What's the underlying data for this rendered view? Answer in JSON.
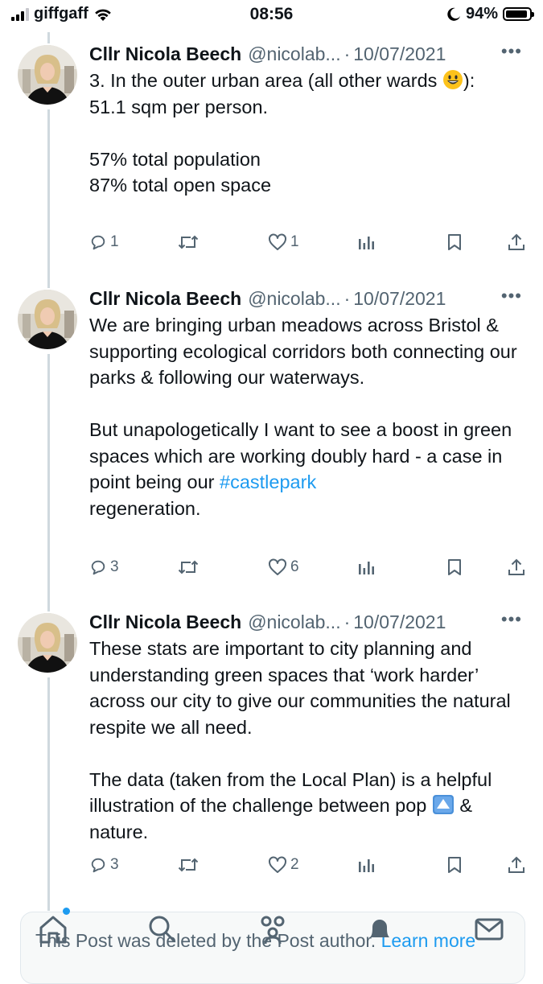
{
  "status_bar": {
    "carrier": "giffgaff",
    "time": "08:56",
    "battery_percent": "94%",
    "battery_level": 0.94
  },
  "tweets": [
    {
      "name": "Cllr Nicola Beech",
      "handle": "@nicolab...",
      "sep": "·",
      "date": "10/07/2021",
      "more": "•••",
      "text_a": "3. In the outer urban area (all other wards",
      "text_b": "):\n51.1 sqm per person.\n\n57% total population\n87% total open space",
      "emoji": "grinning-face-emoji",
      "replies": "1",
      "retweets": "",
      "likes": "1"
    },
    {
      "name": "Cllr Nicola Beech",
      "handle": "@nicolab...",
      "sep": "·",
      "date": "10/07/2021",
      "more": "•••",
      "text_a": "We are bringing urban meadows across Bristol & supporting ecological corridors both connecting our parks & following our waterways.\n\nBut unapologetically I want to see a boost in green spaces which are working doubly hard - a case in point being our ",
      "hashtag": "#castlepark",
      "text_b": "\nregeneration.",
      "replies": "3",
      "retweets": "",
      "likes": "6"
    },
    {
      "name": "Cllr Nicola Beech",
      "handle": "@nicolab...",
      "sep": "·",
      "date": "10/07/2021",
      "more": "•••",
      "text_a": "These stats are important to city planning and understanding green spaces that ‘work harder’ across our city to give our communities the natural respite we all need.\n\nThe data (taken from the Local Plan) is a helpful illustration of the challenge between pop ",
      "emoji": "up-button-emoji",
      "text_b": " & nature.",
      "replies": "3",
      "retweets": "",
      "likes": "2"
    }
  ],
  "deleted_notice": {
    "text": "This Post was deleted by the Post author. ",
    "link": "Learn more"
  },
  "colors": {
    "accent": "#1d9bf0",
    "secondary_text": "#536471",
    "thread_line": "#cfd9de"
  },
  "tab_icons": [
    "home-icon",
    "search-icon",
    "communities-icon",
    "notifications-icon",
    "messages-icon"
  ]
}
